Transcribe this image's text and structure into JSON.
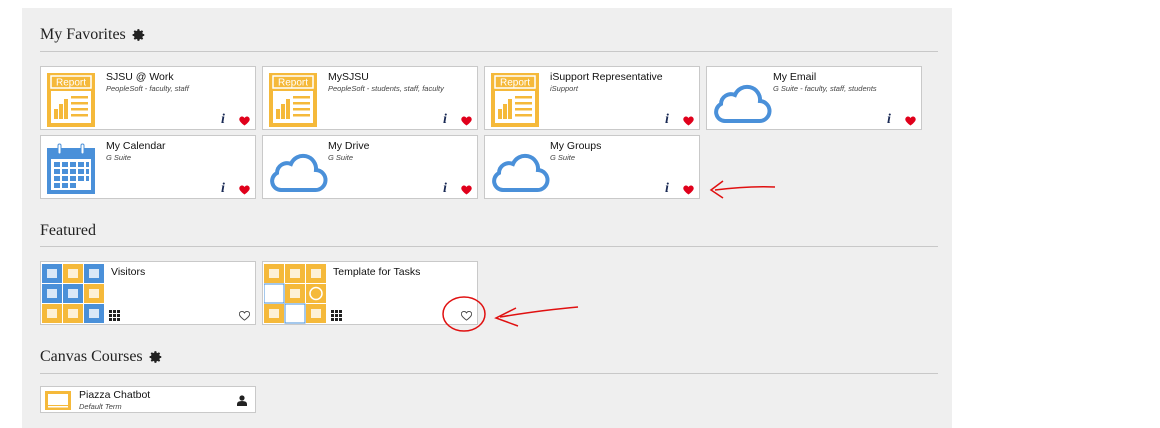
{
  "sections": {
    "favorites_title": "My Favorites",
    "featured_title": "Featured",
    "canvas_title": "Canvas Courses"
  },
  "favorites": [
    {
      "title": "SJSU @ Work",
      "subtitle": "PeopleSoft - faculty, staff",
      "icon": "report-icon",
      "favorited": true
    },
    {
      "title": "MySJSU",
      "subtitle": "PeopleSoft - students, staff, faculty",
      "icon": "report-icon",
      "favorited": true
    },
    {
      "title": "iSupport Representative",
      "subtitle": "iSupport",
      "icon": "report-icon",
      "favorited": true
    },
    {
      "title": "My Email",
      "subtitle": "G Suite - faculty, staff, students",
      "icon": "cloud-icon",
      "favorited": true
    },
    {
      "title": "My Calendar",
      "subtitle": "G Suite",
      "icon": "calendar-icon",
      "favorited": true
    },
    {
      "title": "My Drive",
      "subtitle": "G Suite",
      "icon": "cloud-icon",
      "favorited": true
    },
    {
      "title": "My Groups",
      "subtitle": "G Suite",
      "icon": "cloud-icon",
      "favorited": true
    }
  ],
  "report_label": "Report",
  "featured": [
    {
      "title": "Visitors",
      "icon": "collection-mosaic-icon",
      "favorited": false
    },
    {
      "title": "Template for Tasks",
      "icon": "collection-mosaic-icon",
      "favorited": false
    }
  ],
  "canvas": [
    {
      "title": "Piazza Chatbot",
      "subtitle": "Default Term",
      "icon": "course-icon"
    }
  ],
  "info_label": "i",
  "colors": {
    "heart": "#e0001b",
    "report": "#f5b93a",
    "cloud": "#4a90d9",
    "annotation": "#e01010"
  }
}
